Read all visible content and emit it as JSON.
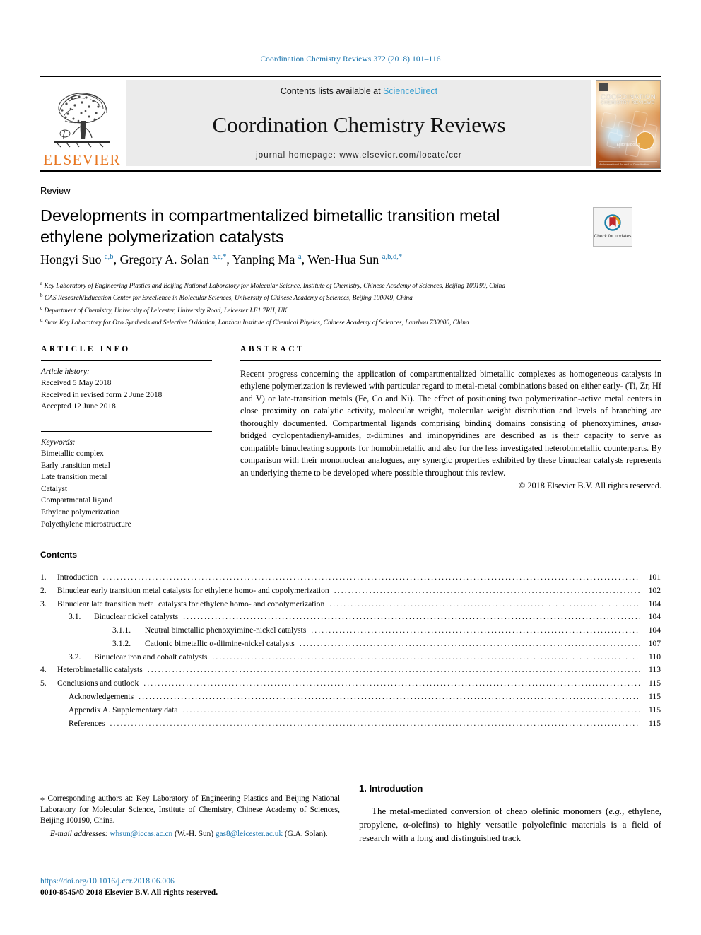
{
  "running_head": "Coordination Chemistry Reviews 372 (2018) 101–116",
  "masthead": {
    "publisher_logo_text": "ELSEVIER",
    "contents_prefix": "Contents lists available at ",
    "sciencedirect": "ScienceDirect",
    "journal_name": "Coordination Chemistry Reviews",
    "homepage": "journal homepage: www.elsevier.com/locate/ccr",
    "cover": {
      "title": "COORDINATION",
      "subtitle": "CHEMISTRY REVIEWS",
      "footer": "An International Journal of Coordination Chemistry"
    }
  },
  "article": {
    "doctype": "Review",
    "title": "Developments in compartmentalized bimetallic transition metal ethylene polymerization catalysts",
    "crossmark_label": "Check for updates",
    "authors_html": "Hongyi Suo <sup>a,b</sup>, Gregory A. Solan <sup>a,c,</sup><sup>*</sup>, Yanping Ma <sup>a</sup>, Wen-Hua Sun <sup>a,b,d,</sup><sup>*</sup>",
    "affiliations": [
      {
        "marker": "a",
        "text": "Key Laboratory of Engineering Plastics and Beijing National Laboratory for Molecular Science, Institute of Chemistry, Chinese Academy of Sciences, Beijing 100190, China"
      },
      {
        "marker": "b",
        "text": "CAS Research/Education Center for Excellence in Molecular Sciences, University of Chinese Academy of Sciences, Beijing 100049, China"
      },
      {
        "marker": "c",
        "text": "Department of Chemistry, University of Leicester, University Road, Leicester LE1 7RH, UK"
      },
      {
        "marker": "d",
        "text": "State Key Laboratory for Oxo Synthesis and Selective Oxidation, Lanzhou Institute of Chemical Physics, Chinese Academy of Sciences, Lanzhou 730000, China"
      }
    ]
  },
  "article_info": {
    "heading": "ARTICLE INFO",
    "history_label": "Article history:",
    "history": [
      "Received 5 May 2018",
      "Received in revised form 2 June 2018",
      "Accepted 12 June 2018"
    ],
    "keywords_label": "Keywords:",
    "keywords": [
      "Bimetallic complex",
      "Early transition metal",
      "Late transition metal",
      "Catalyst",
      "Compartmental ligand",
      "Ethylene polymerization",
      "Polyethylene microstructure"
    ]
  },
  "abstract": {
    "heading": "ABSTRACT",
    "body_html": "Recent progress concerning the application of compartmentalized bimetallic complexes as homogeneous catalysts in ethylene polymerization is reviewed with particular regard to metal-metal combinations based on either early- (Ti, Zr, Hf and V) or late-transition metals (Fe, Co and Ni). The effect of positioning two polymerization-active metal centers in close proximity on catalytic activity, molecular weight, molecular weight distribution and levels of branching are thoroughly documented. Compartmental ligands comprising binding domains consisting of phenoxyimines, <i>ansa</i>-bridged cyclopentadienyl-amides, &alpha;-diimines and iminopyridines are described as is their capacity to serve as compatible binucleating supports for homobimetallic and also for the less investigated heterobimetallic counterparts. By comparison with their mononuclear analogues, any synergic properties exhibited by these binuclear catalysts represents an underlying theme to be developed where possible throughout this review.",
    "copyright": "© 2018 Elsevier B.V. All rights reserved."
  },
  "contents": {
    "heading": "Contents",
    "entries": [
      {
        "level": 1,
        "number": "1.",
        "label": "Introduction",
        "page": "101"
      },
      {
        "level": 1,
        "number": "2.",
        "label": "Binuclear early transition metal catalysts for ethylene homo- and copolymerization",
        "page": "102"
      },
      {
        "level": 1,
        "number": "3.",
        "label": "Binuclear late transition metal catalysts for ethylene homo- and copolymerization",
        "page": "104"
      },
      {
        "level": 2,
        "number": "3.1.",
        "label": "Binuclear nickel catalysts",
        "page": "104"
      },
      {
        "level": 3,
        "number": "3.1.1.",
        "label": "Neutral bimetallic phenoxyimine-nickel catalysts",
        "page": "104"
      },
      {
        "level": 3,
        "number": "3.1.2.",
        "label": "Cationic bimetallic α-diimine-nickel catalysts",
        "page": "107"
      },
      {
        "level": 2,
        "number": "3.2.",
        "label": "Binuclear iron and cobalt catalysts",
        "page": "110"
      },
      {
        "level": 1,
        "number": "4.",
        "label": "Heterobimetallic catalysts",
        "page": "113"
      },
      {
        "level": 1,
        "number": "5.",
        "label": "Conclusions and outlook",
        "page": "115"
      },
      {
        "level": 4,
        "number": "",
        "label": "Acknowledgements",
        "page": "115"
      },
      {
        "level": 4,
        "number": "",
        "label": "Appendix A.   Supplementary data",
        "page": "115"
      },
      {
        "level": 4,
        "number": "",
        "label": "References",
        "page": "115"
      }
    ]
  },
  "footnote": {
    "corresponding_html": "<span class=\"star\">⁎</span> Corresponding authors at: Key Laboratory of Engineering Plastics and Beijing National Laboratory for Molecular Science, Institute of Chemistry, Chinese Academy of Sciences, Beijing 100190, China.",
    "email_label": "E-mail addresses:",
    "email_1": "whsun@iccas.ac.cn",
    "email_1_owner": "(W.-H. Sun)",
    "email_2": "gas8@leicester.ac.uk",
    "email_2_owner": "(G.A. Solan).",
    "doi": "https://doi.org/10.1016/j.ccr.2018.06.006",
    "issn_line": "0010-8545/© 2018 Elsevier B.V. All rights reserved."
  },
  "introduction": {
    "heading": "1. Introduction",
    "paragraph_html": "The metal-mediated conversion of cheap olefinic monomers (<i>e.g.</i>, ethylene, propylene, α-olefins) to highly versatile polyolefinic materials is a field of research with a long and distinguished track"
  },
  "colors": {
    "link": "#1a74ad",
    "sciencedirect": "#3aa0d1",
    "elsevier_orange": "#E87722",
    "band_bg": "#ebebeb"
  }
}
